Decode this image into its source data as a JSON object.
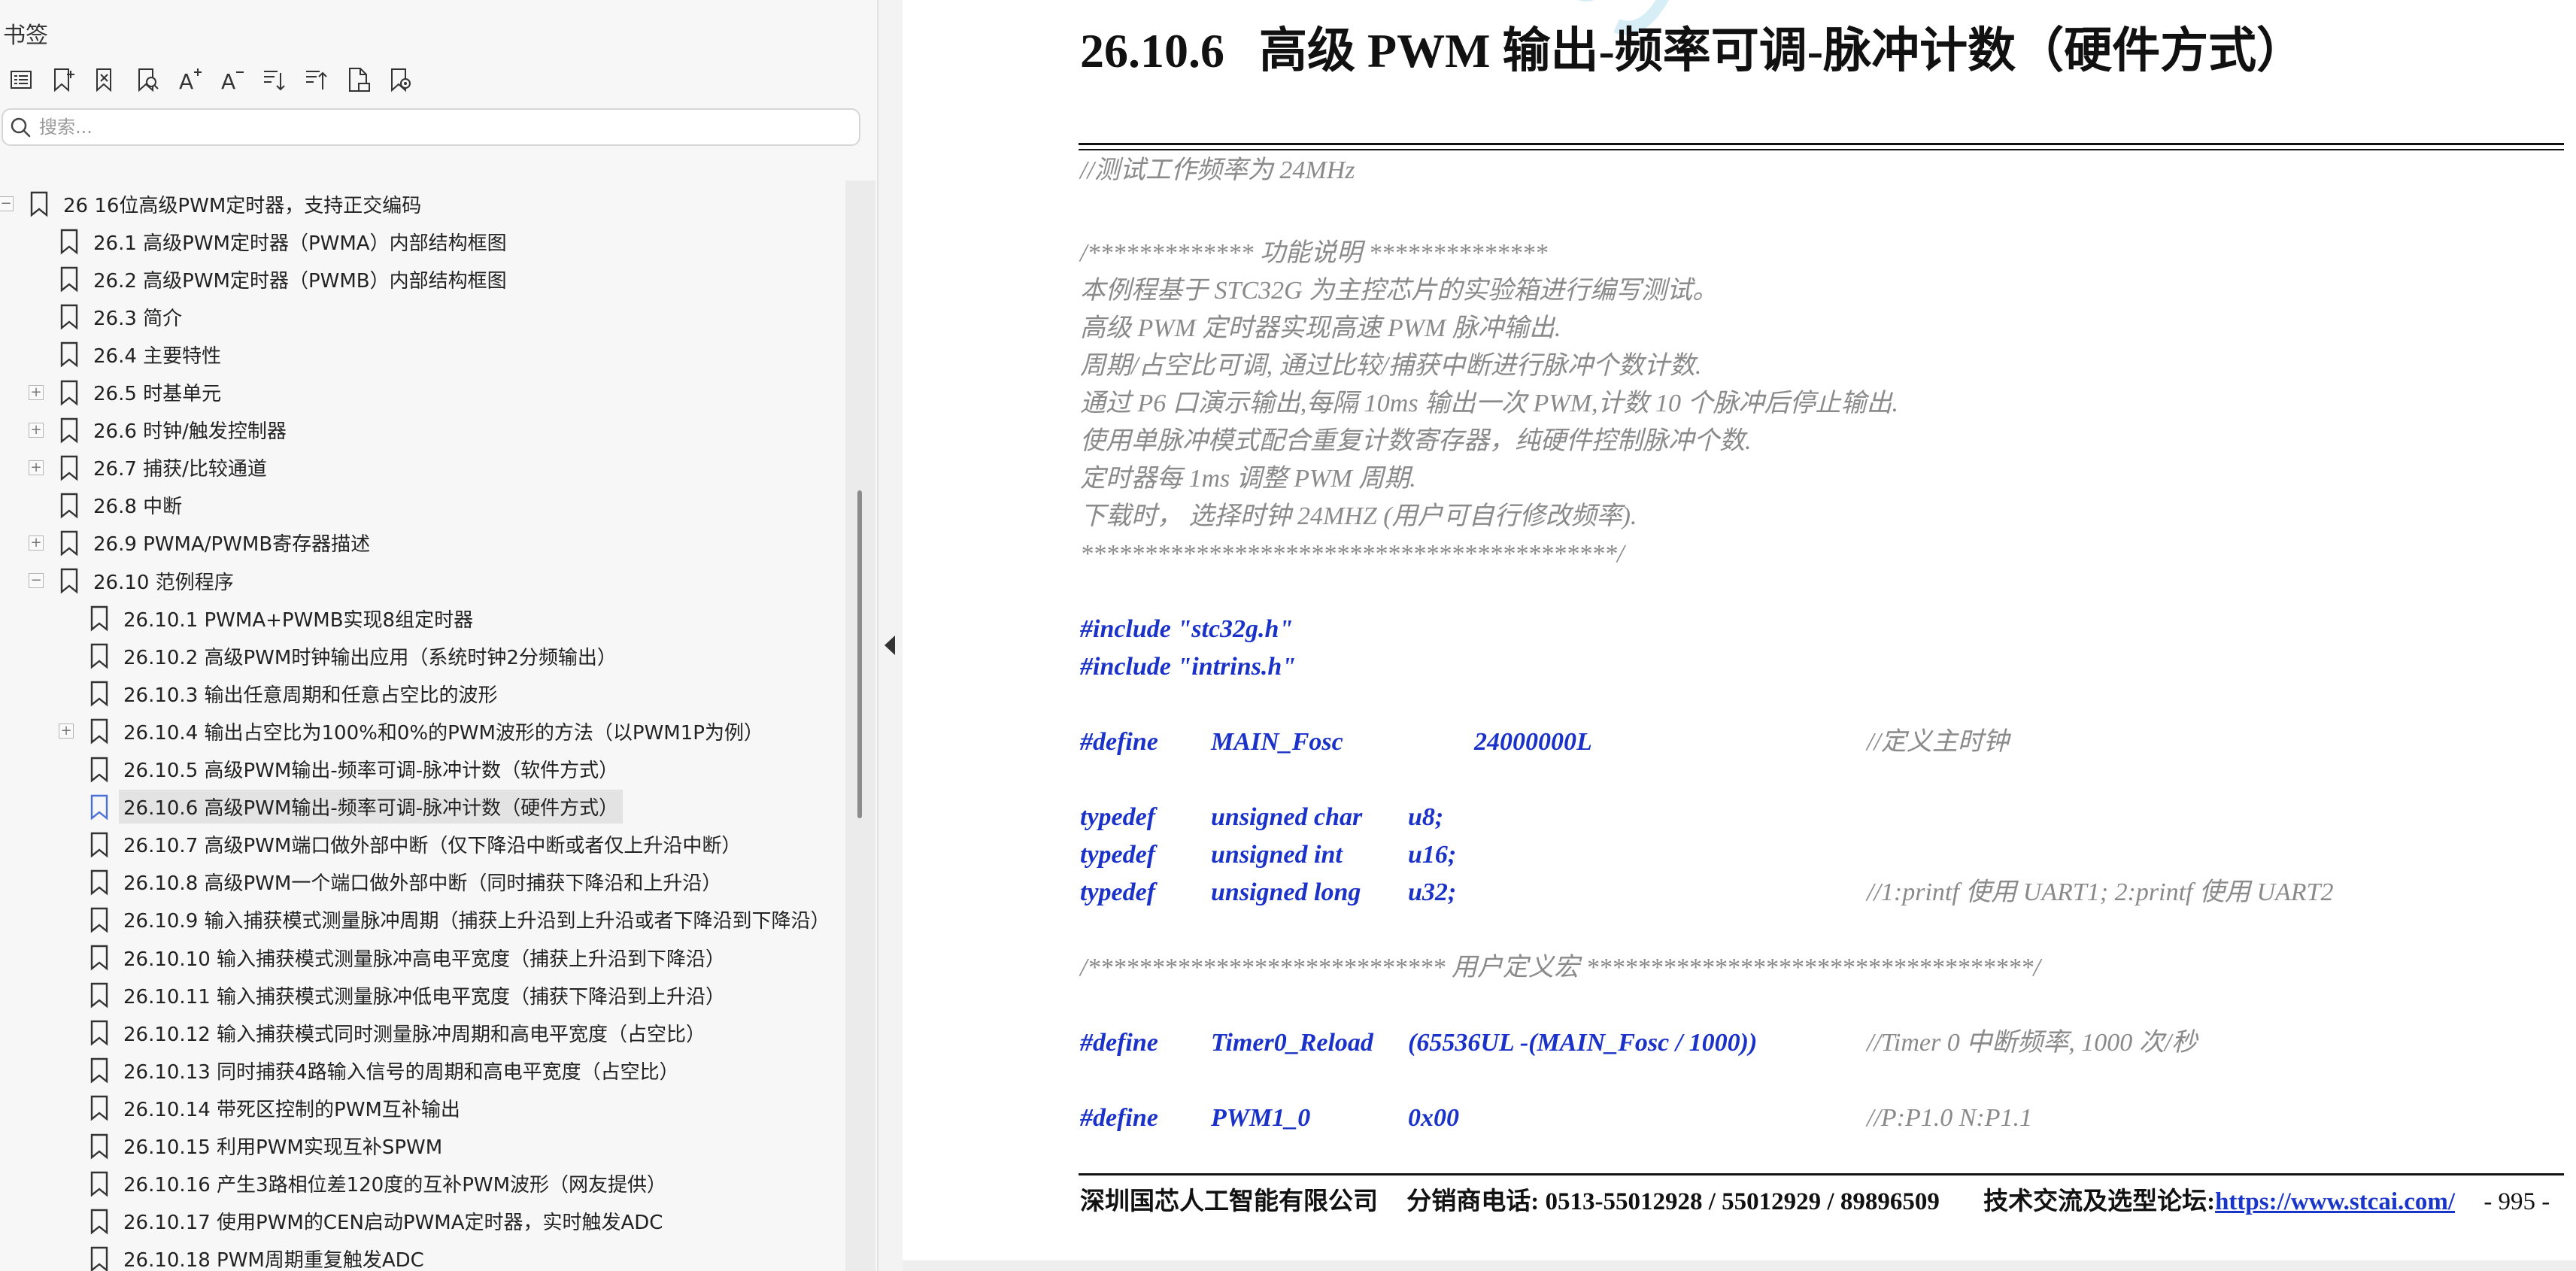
{
  "sidebar": {
    "title": "书签",
    "toolbar": [
      {
        "icon": "list-icon"
      },
      {
        "icon": "bookmark-add-icon"
      },
      {
        "icon": "bookmark-delete-icon"
      },
      {
        "icon": "bookmark-search-icon"
      },
      {
        "icon": "font-increase-icon"
      },
      {
        "icon": "font-decrease-icon"
      },
      {
        "icon": "expand-all-icon"
      },
      {
        "icon": "collapse-all-icon"
      },
      {
        "icon": "bookmark-page-icon"
      },
      {
        "icon": "bookmark-settings-icon"
      }
    ],
    "search": {
      "placeholder": "搜索..."
    },
    "tree": [
      {
        "label": "26  16位高级PWM定时器，支持正交编码",
        "level": 0,
        "expander": "minus"
      },
      {
        "label": "26.1  高级PWM定时器（PWMA）内部结构框图",
        "level": 1,
        "expander": ""
      },
      {
        "label": "26.2  高级PWM定时器（PWMB）内部结构框图",
        "level": 1,
        "expander": ""
      },
      {
        "label": "26.3  简介",
        "level": 1,
        "expander": ""
      },
      {
        "label": "26.4 主要特性",
        "level": 1,
        "expander": ""
      },
      {
        "label": "26.5 时基单元",
        "level": 1,
        "expander": "plus"
      },
      {
        "label": "26.6 时钟/触发控制器",
        "level": 1,
        "expander": "plus"
      },
      {
        "label": "26.7 捕获/比较通道",
        "level": 1,
        "expander": "plus"
      },
      {
        "label": "26.8 中断",
        "level": 1,
        "expander": ""
      },
      {
        "label": "26.9  PWMA/PWMB寄存器描述",
        "level": 1,
        "expander": "plus"
      },
      {
        "label": "26.10  范例程序",
        "level": 1,
        "expander": "minus"
      },
      {
        "label": "26.10.1 PWMA+PWMB实现8组定时器",
        "level": 2,
        "expander": ""
      },
      {
        "label": "26.10.2 高级PWM时钟输出应用（系统时钟2分频输出）",
        "level": 2,
        "expander": ""
      },
      {
        "label": "26.10.3 输出任意周期和任意占空比的波形",
        "level": 2,
        "expander": ""
      },
      {
        "label": "26.10.4  输出占空比为100%和0%的PWM波形的方法（以PWM1P为例）",
        "level": 2,
        "expander": "plus"
      },
      {
        "label": "26.10.5 高级PWM输出-频率可调-脉冲计数（软件方式）",
        "level": 2,
        "expander": ""
      },
      {
        "label": "26.10.6 高级PWM输出-频率可调-脉冲计数（硬件方式）",
        "level": 2,
        "expander": "",
        "active": true
      },
      {
        "label": "26.10.7 高级PWM端口做外部中断（仅下降沿中断或者仅上升沿中断）",
        "level": 2,
        "expander": ""
      },
      {
        "label": "26.10.8 高级PWM一个端口做外部中断（同时捕获下降沿和上升沿）",
        "level": 2,
        "expander": ""
      },
      {
        "label": "26.10.9 输入捕获模式测量脉冲周期（捕获上升沿到上升沿或者下降沿到下降沿）",
        "level": 2,
        "expander": ""
      },
      {
        "label": "26.10.10  输入捕获模式测量脉冲高电平宽度（捕获上升沿到下降沿）",
        "level": 2,
        "expander": ""
      },
      {
        "label": "26.10.11  输入捕获模式测量脉冲低电平宽度（捕获下降沿到上升沿）",
        "level": 2,
        "expander": ""
      },
      {
        "label": "26.10.12  输入捕获模式同时测量脉冲周期和高电平宽度（占空比）",
        "level": 2,
        "expander": ""
      },
      {
        "label": "26.10.13  同时捕获4路输入信号的周期和高电平宽度（占空比）",
        "level": 2,
        "expander": ""
      },
      {
        "label": "26.10.14 带死区控制的PWM互补输出",
        "level": 2,
        "expander": ""
      },
      {
        "label": "26.10.15 利用PWM实现互补SPWM",
        "level": 2,
        "expander": ""
      },
      {
        "label": "26.10.16  产生3路相位差120度的互补PWM波形（网友提供）",
        "level": 2,
        "expander": ""
      },
      {
        "label": "26.10.17 使用PWM的CEN启动PWMA定时器，实时触发ADC",
        "level": 2,
        "expander": ""
      },
      {
        "label": "26.10.18 PWM周期重复触发ADC",
        "level": 2,
        "expander": ""
      }
    ]
  },
  "document": {
    "watermark": "STC M",
    "heading_number": "26.10.6",
    "heading_title": "高级 PWM 输出-频率可调-脉冲计数（硬件方式）",
    "lines": [
      {
        "text": "//测试工作频率为 24MHz",
        "kind": "cmt"
      },
      {
        "text": "/************* 功能说明  **************",
        "kind": "cmt"
      },
      {
        "text": "本例程基于 STC32G 为主控芯片的实验箱进行编写测试。",
        "kind": "cmt"
      },
      {
        "text": "高级 PWM 定时器实现高速 PWM 脉冲输出.",
        "kind": "cmt"
      },
      {
        "text": "周期/占空比可调, 通过比较/捕获中断进行脉冲个数计数.",
        "kind": "cmt"
      },
      {
        "text": "通过 P6 口演示输出,每隔 10ms 输出一次 PWM,计数 10 个脉冲后停止输出.",
        "kind": "cmt"
      },
      {
        "text": "使用单脉冲模式配合重复计数寄存器，纯硬件控制脉冲个数.",
        "kind": "cmt"
      },
      {
        "text": "定时器每 1ms 调整 PWM 周期.",
        "kind": "cmt"
      },
      {
        "text": "下载时，    选择时钟  24MHZ (用户可自行修改频率).",
        "kind": "cmt"
      },
      {
        "text": "******************************************/",
        "kind": "cmt"
      },
      {
        "text": "#include \"stc32g.h\"",
        "kind": "kw"
      },
      {
        "text": "#include \"intrins.h\"",
        "kind": "kw"
      },
      {
        "text": "/****************************  用户定义宏  ***********************************/",
        "kind": "cmt"
      }
    ],
    "define_main": {
      "kw": "#define",
      "name": "MAIN_Fosc",
      "value": "24000000L",
      "comment": "//定义主时钟"
    },
    "typedefs": [
      {
        "kw": "typedef",
        "type": "unsigned char",
        "name": "u8;",
        "comment": ""
      },
      {
        "kw": "typedef",
        "type": "unsigned int",
        "name": "u16;",
        "comment": ""
      },
      {
        "kw": "typedef",
        "type": "unsigned long",
        "name": "u32;",
        "comment": "//1:printf  使用  UART1; 2:printf  使用  UART2"
      }
    ],
    "define_reload": {
      "kw": "#define",
      "name": "Timer0_Reload",
      "value": "(65536UL -(MAIN_Fosc / 1000))",
      "comment": "//Timer      0  中断频率, 1000 次/秒"
    },
    "define_pwm": {
      "kw": "#define",
      "name": "PWM1_0",
      "value": "0x00",
      "comment": "//P:P1.0    N:P1.1"
    },
    "footer": {
      "company": "深圳国芯人工智能有限公司",
      "phone": "分销商电话: 0513-55012928 / 55012929 / 89896509",
      "forum_label": "技术交流及选型论坛:",
      "url": "https://www.stcai.com/",
      "page": "- 995 -"
    }
  }
}
